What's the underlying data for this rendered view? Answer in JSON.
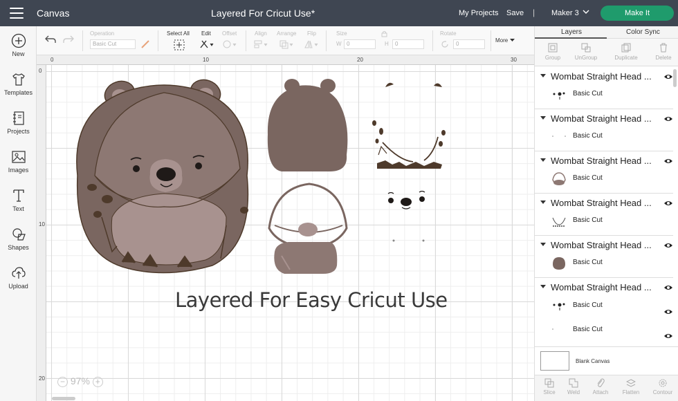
{
  "topbar": {
    "app_title": "Canvas",
    "doc_title": "Layered For Cricut Use*",
    "my_projects": "My Projects",
    "save": "Save",
    "separator": "|",
    "machine": "Maker 3",
    "make_it": "Make It"
  },
  "leftbar": {
    "tools": [
      {
        "label": "New",
        "icon": "plus-circle-icon"
      },
      {
        "label": "Templates",
        "icon": "tshirt-icon"
      },
      {
        "label": "Projects",
        "icon": "notebook-icon"
      },
      {
        "label": "Images",
        "icon": "image-icon"
      },
      {
        "label": "Text",
        "icon": "text-icon"
      },
      {
        "label": "Shapes",
        "icon": "shapes-icon"
      },
      {
        "label": "Upload",
        "icon": "upload-cloud-icon"
      }
    ]
  },
  "toolbar": {
    "operation_label": "Operation",
    "operation_value": "Basic Cut",
    "select_all": "Select All",
    "edit": "Edit",
    "offset": "Offset",
    "align": "Align",
    "arrange": "Arrange",
    "flip": "Flip",
    "size": "Size",
    "w_label": "W",
    "h_label": "H",
    "w_value": "0",
    "h_value": "0",
    "rotate": "Rotate",
    "rotate_value": "0",
    "more": "More"
  },
  "canvas": {
    "ruler_h": [
      "0",
      "10",
      "20",
      "30"
    ],
    "ruler_v": [
      "0",
      "10",
      "20"
    ],
    "overlay_text": "Layered For Easy Cricut Use",
    "zoom": "97%",
    "zoom_minus": "−",
    "zoom_plus": "+"
  },
  "rightpanel": {
    "tabs": [
      "Layers",
      "Color Sync"
    ],
    "actions": [
      "Group",
      "UnGroup",
      "Duplicate",
      "Delete"
    ],
    "layers": [
      {
        "title": "Wombat Straight Head ...",
        "sub": "Basic Cut"
      },
      {
        "title": "Wombat Straight Head ...",
        "sub": "Basic Cut"
      },
      {
        "title": "Wombat Straight Head ...",
        "sub": "Basic Cut"
      },
      {
        "title": "Wombat Straight Head ...",
        "sub": "Basic Cut"
      },
      {
        "title": "Wombat Straight Head ...",
        "sub": "Basic Cut"
      },
      {
        "title": "Wombat Straight Head ...",
        "sub": "Basic Cut",
        "sub2": "Basic Cut"
      }
    ],
    "blank_canvas": "Blank Canvas",
    "bottom_actions": [
      "Slice",
      "Weld",
      "Attach",
      "Flatten",
      "Contour"
    ]
  },
  "colors": {
    "topbar": "#3f4652",
    "make_it": "#1f9b6c",
    "wombat_dark": "#7a6660",
    "wombat_light": "#a8928f",
    "wombat_mid": "#8d7873",
    "wombat_brown": "#4e3a2b"
  }
}
